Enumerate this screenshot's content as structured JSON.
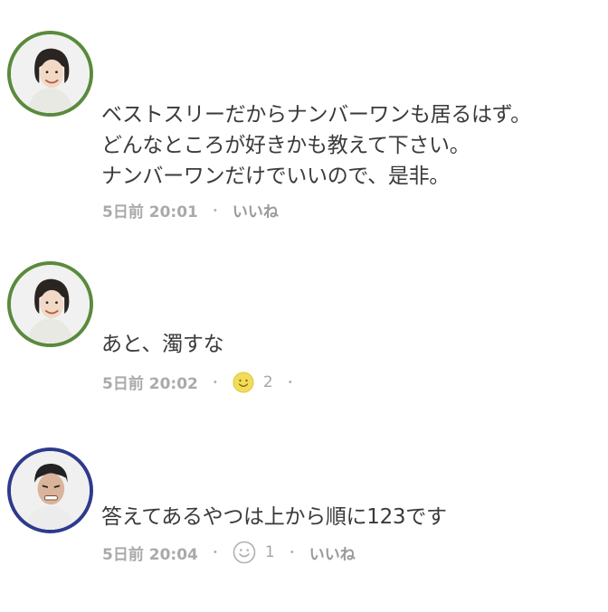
{
  "comments": [
    {
      "lines": [
        "ベストスリーだからナンバーワンも居るはず。",
        "どんなところが好きかも教えて下さい。",
        "ナンバーワンだけでいいので、是非。"
      ],
      "time": "5日前 20:01",
      "like_label": "いいね",
      "avatar_ring": "#5a8a3c"
    },
    {
      "lines": [
        "あと、濁すな"
      ],
      "time": "5日前 20:02",
      "reaction_count": "2",
      "reaction_icon": "smile-filled-icon",
      "avatar_ring": "#5a8a3c"
    },
    {
      "lines": [
        "答えてあるやつは上から順に123です"
      ],
      "time": "5日前 20:04",
      "reaction_count": "1",
      "reaction_icon": "smile-outline-icon",
      "like_label": "いいね",
      "avatar_ring": "#2e3a8c"
    }
  ],
  "separator": "・"
}
